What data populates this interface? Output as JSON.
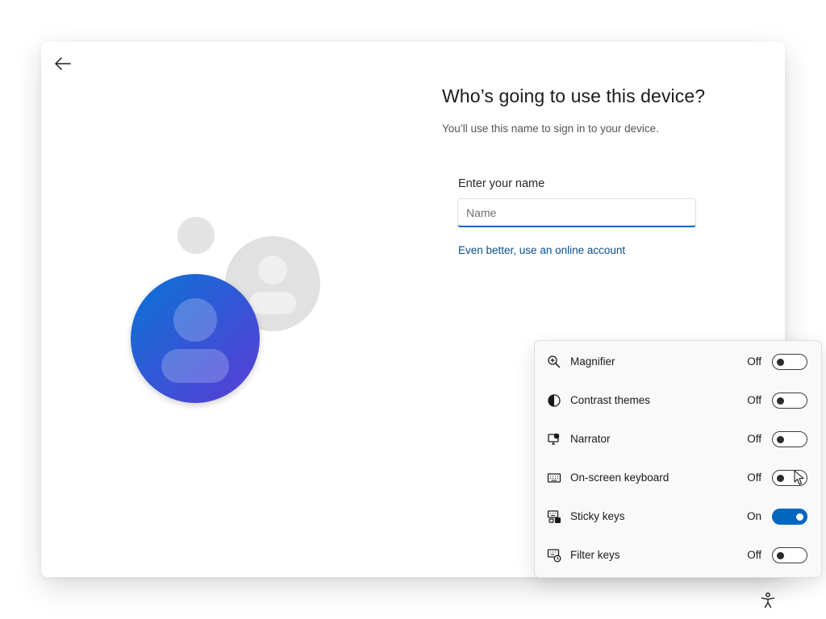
{
  "colors": {
    "accent": "#0067c0",
    "link": "#0a4f8c",
    "avatar_gradient_start": "#0a74d6",
    "avatar_gradient_end": "#5b3bd6"
  },
  "header": {
    "back_icon": "arrow-left-icon"
  },
  "main": {
    "title": "Who’s going to use this device?",
    "subtitle": "You’ll use this name to sign in to your device.",
    "name_label": "Enter your name",
    "name_placeholder": "Name",
    "name_value": "",
    "online_account_link": "Even better, use an online account"
  },
  "accessibility_panel": {
    "items": [
      {
        "label": "Magnifier",
        "state": "Off",
        "on": false,
        "icon": "magnifier-icon"
      },
      {
        "label": "Contrast themes",
        "state": "Off",
        "on": false,
        "icon": "contrast-icon"
      },
      {
        "label": "Narrator",
        "state": "Off",
        "on": false,
        "icon": "narrator-icon"
      },
      {
        "label": "On-screen keyboard",
        "state": "Off",
        "on": false,
        "icon": "keyboard-icon"
      },
      {
        "label": "Sticky keys",
        "state": "On",
        "on": true,
        "icon": "sticky-keys-icon"
      },
      {
        "label": "Filter keys",
        "state": "Off",
        "on": false,
        "icon": "filter-keys-icon"
      }
    ]
  },
  "footer": {
    "accessibility_icon": "accessibility-icon"
  }
}
